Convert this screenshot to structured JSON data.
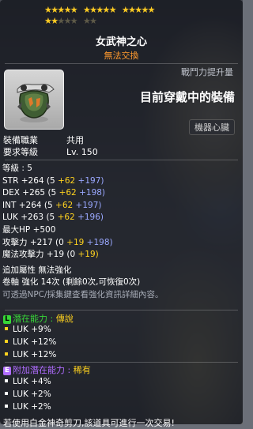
{
  "stars": {
    "total": 22,
    "filled": 17,
    "per_row": 15
  },
  "item": {
    "name": "女武神之心",
    "trade_status": "無法交換",
    "icon_name": "valkyrie-heart-icon"
  },
  "header_right": {
    "power_label": "戰鬥力提升量",
    "equipped_label": "目前穿戴中的裝備",
    "category_tag": "機器心臟"
  },
  "requirements": [
    {
      "key": "裝備職業",
      "value": "共用"
    },
    {
      "key": "要求等級",
      "value": "Lv. 150"
    }
  ],
  "stats": {
    "grade": "等級 : 5",
    "str": {
      "label": "STR",
      "total": "+264",
      "base": "(5",
      "flame": "+62",
      "enhance": "+197)"
    },
    "dex": {
      "label": "DEX",
      "total": "+265",
      "base": "(5",
      "flame": "+62",
      "enhance": "+198)"
    },
    "int": {
      "label": "INT",
      "total": "+264",
      "base": "(5",
      "flame": "+62",
      "enhance": "+197)"
    },
    "luk": {
      "label": "LUK",
      "total": "+263",
      "base": "(5",
      "flame": "+62",
      "enhance": "+196)"
    },
    "maxhp": {
      "label": "最大HP",
      "value": "+500"
    },
    "atk": {
      "label": "攻擊力",
      "total": "+217",
      "base": "(0",
      "flame": "+19",
      "enhance": "+198)"
    },
    "matk": {
      "label": "魔法攻擊力",
      "total": "+19",
      "base": "(0",
      "flame": "+19)"
    },
    "extra": "追加屬性 無法強化",
    "scroll": "卷軸 強化 14次 (剩餘0次,可恢復0次)",
    "hint": "可透過NPC/採集鍵查看強化資訊詳細內容。"
  },
  "potential": {
    "badge": "L",
    "title": "潛在能力 : ",
    "grade": "傳說",
    "lines": [
      "LUK +9%",
      "LUK +12%",
      "LUK +12%"
    ]
  },
  "bonus_potential": {
    "badge": "E",
    "title": "附加潛在能力 : ",
    "grade": "稀有",
    "lines": [
      "LUK +4%",
      "LUK +2%",
      "LUK +2%"
    ]
  },
  "footer": {
    "note": "若使用白金神奇剪刀,該道具可進行一次交易!"
  },
  "colors": {
    "star": "#ffcc22",
    "flame": "#ffd21f",
    "enhance": "#9aa8ff",
    "trade": "#ff9a2e",
    "legendary": "#37d637",
    "epic": "#b06cff"
  }
}
